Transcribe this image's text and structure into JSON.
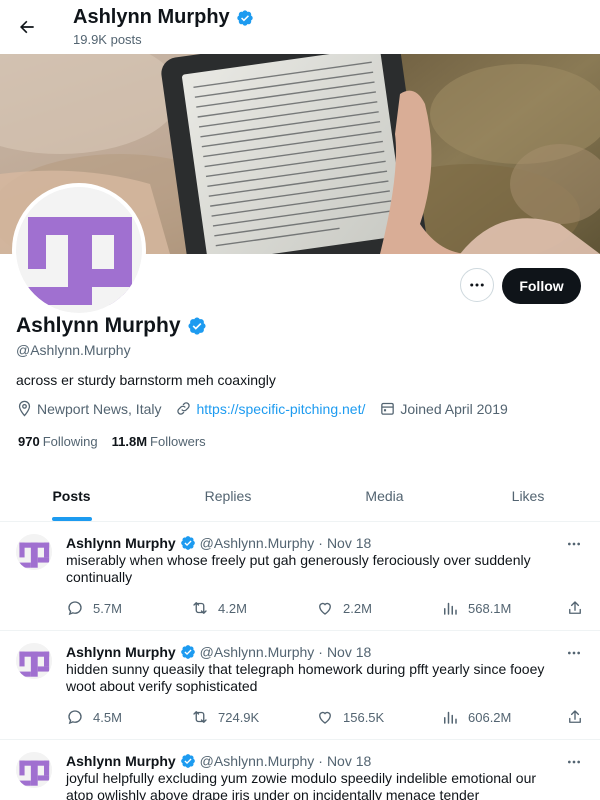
{
  "header": {
    "title": "Ashlynn Murphy",
    "posts_count": "19.9K posts"
  },
  "profile": {
    "name": "Ashlynn Murphy",
    "handle": "@Ashlynn.Murphy",
    "bio": "across er sturdy barnstorm meh coaxingly",
    "location": "Newport News, Italy",
    "website": "https://specific-pitching.net/",
    "joined": "Joined April 2019",
    "following_count": "970",
    "following_label": "Following",
    "followers_count": "11.8M",
    "followers_label": "Followers",
    "follow_label": "Follow"
  },
  "tabs": [
    {
      "label": "Posts",
      "active": true
    },
    {
      "label": "Replies",
      "active": false
    },
    {
      "label": "Media",
      "active": false
    },
    {
      "label": "Likes",
      "active": false
    }
  ],
  "posts": [
    {
      "name": "Ashlynn Murphy",
      "handle": "@Ashlynn.Murphy",
      "date": "Nov 18",
      "text": "miserably when whose freely put gah generously ferociously over suddenly continually",
      "replies": "5.7M",
      "reposts": "4.2M",
      "likes": "2.2M",
      "views": "568.1M"
    },
    {
      "name": "Ashlynn Murphy",
      "handle": "@Ashlynn.Murphy",
      "date": "Nov 18",
      "text": "hidden sunny queasily that telegraph homework during pfft yearly since fooey woot about verify sophisticated",
      "replies": "4.5M",
      "reposts": "724.9K",
      "likes": "156.5K",
      "views": "606.2M"
    },
    {
      "name": "Ashlynn Murphy",
      "handle": "@Ashlynn.Murphy",
      "date": "Nov 18",
      "text": "joyful helpfully excluding yum zowie modulo speedily indelible emotional our atop owlishly above drape iris under on incidentally menace tender"
    }
  ],
  "colors": {
    "accent": "#1d9bf0",
    "avatar_purple": "#a070d0",
    "text_primary": "#0f1419",
    "text_secondary": "#536471"
  },
  "icons": [
    "back-arrow-icon",
    "verified-badge-icon",
    "more-dots-icon",
    "location-pin-icon",
    "link-icon",
    "calendar-icon",
    "reply-icon",
    "repost-icon",
    "like-icon",
    "views-icon",
    "share-icon"
  ]
}
